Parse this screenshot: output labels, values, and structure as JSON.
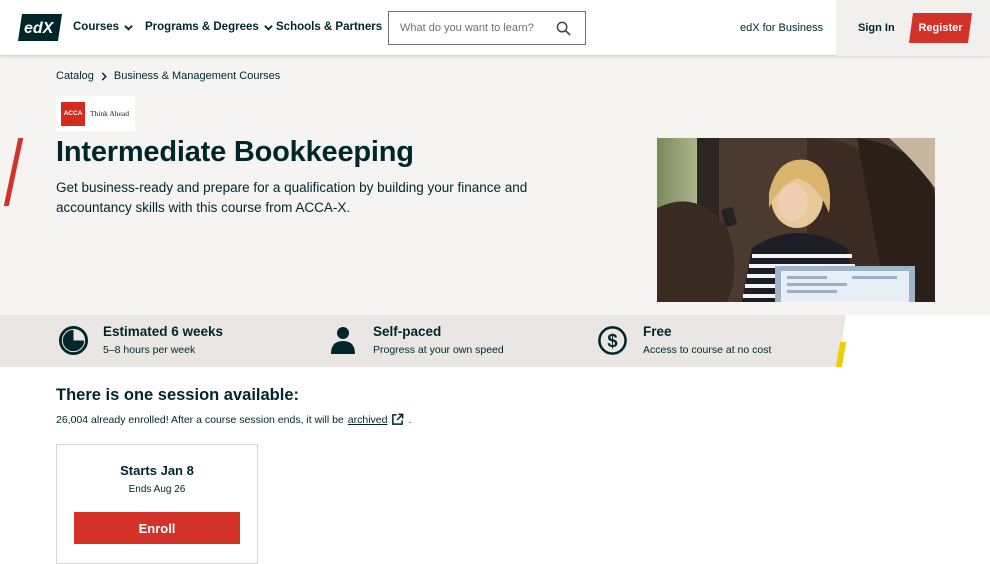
{
  "header": {
    "logo_text": "edX",
    "nav": [
      {
        "label": "Courses"
      },
      {
        "label": "Programs & Degrees"
      },
      {
        "label": "Schools & Partners"
      }
    ],
    "search_placeholder": "What do you want to learn?",
    "business_link": "edX for Business",
    "sign_in": "Sign In",
    "register": "Register"
  },
  "breadcrumb": [
    "Catalog",
    "Business & Management Courses"
  ],
  "partner_logo": {
    "mark": "ACCA",
    "tagline": "Think Ahead"
  },
  "course": {
    "title": "Intermediate Bookkeeping",
    "description": "Get business-ready and prepare for a qualification by building your finance and accountancy skills with this course from ACCA-X."
  },
  "stats": [
    {
      "icon": "clock-icon",
      "title": "Estimated 6 weeks",
      "sub": "5–8 hours per week"
    },
    {
      "icon": "person-icon",
      "title": "Self-paced",
      "sub": "Progress at your own speed"
    },
    {
      "icon": "dollar-icon",
      "title": "Free",
      "sub": "Access to course at no cost"
    }
  ],
  "sessions": {
    "heading": "There is one session available:",
    "enrolled_text": "26,004 already enrolled! After a course session ends, it will be",
    "archived_link": "archived",
    "period": ".",
    "card": {
      "starts": "Starts Jan 8",
      "ends": "Ends Aug 26",
      "enroll": "Enroll"
    }
  },
  "colors": {
    "brand_red": "#d23228",
    "accent_yellow": "#f0cc00",
    "text": "#00262b"
  }
}
